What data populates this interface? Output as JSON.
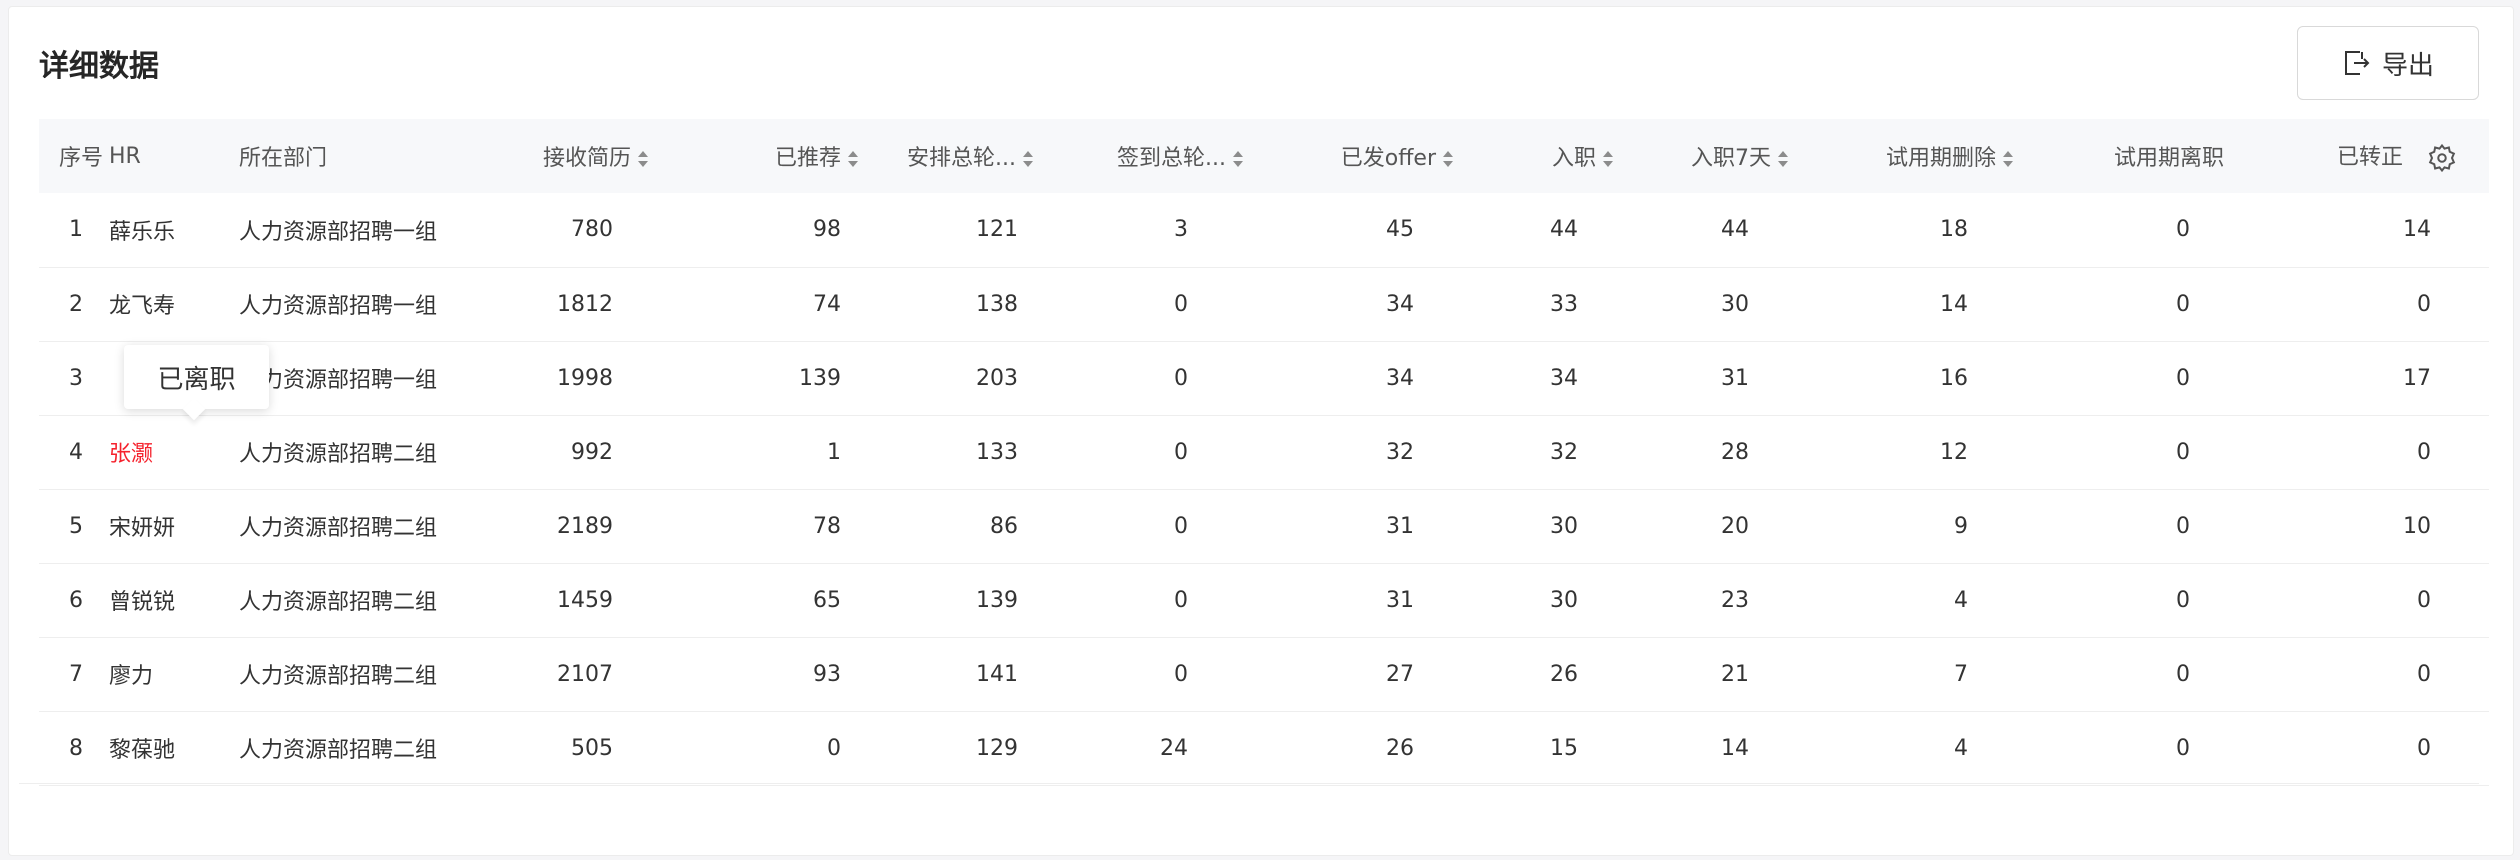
{
  "title": "详细数据",
  "export_label": "导出",
  "tooltip": "已离职",
  "columns": [
    {
      "label": "序号",
      "sortable": false
    },
    {
      "label": "HR",
      "sortable": false
    },
    {
      "label": "所在部门",
      "sortable": false
    },
    {
      "label": "接收简历",
      "sortable": true
    },
    {
      "label": "已推荐",
      "sortable": true
    },
    {
      "label": "安排总轮...",
      "sortable": true
    },
    {
      "label": "签到总轮...",
      "sortable": true
    },
    {
      "label": "已发offer",
      "sortable": true
    },
    {
      "label": "入职",
      "sortable": true
    },
    {
      "label": "入职7天",
      "sortable": true
    },
    {
      "label": "试用期删除",
      "sortable": true
    },
    {
      "label": "试用期离职",
      "sortable": false
    },
    {
      "label": "已转正",
      "sortable": false
    }
  ],
  "rows": [
    [
      "1",
      "薛乐乐",
      "人力资源部招聘一组",
      "780",
      "98",
      "121",
      "3",
      "45",
      "44",
      "44",
      "18",
      "0",
      "14"
    ],
    [
      "2",
      "龙飞寿",
      "人力资源部招聘一组",
      "1812",
      "74",
      "138",
      "0",
      "34",
      "33",
      "30",
      "14",
      "0",
      "0"
    ],
    [
      "3",
      "",
      "人力资源部招聘一组",
      "1998",
      "139",
      "203",
      "0",
      "34",
      "34",
      "31",
      "16",
      "0",
      "17"
    ],
    [
      "4",
      "张灏",
      "人力资源部招聘二组",
      "992",
      "1",
      "133",
      "0",
      "32",
      "32",
      "28",
      "12",
      "0",
      "0"
    ],
    [
      "5",
      "宋妍妍",
      "人力资源部招聘二组",
      "2189",
      "78",
      "86",
      "0",
      "31",
      "30",
      "20",
      "9",
      "0",
      "10"
    ],
    [
      "6",
      "曾锐锐",
      "人力资源部招聘二组",
      "1459",
      "65",
      "139",
      "0",
      "31",
      "30",
      "23",
      "4",
      "0",
      "0"
    ],
    [
      "7",
      "廖力",
      "人力资源部招聘二组",
      "2107",
      "93",
      "141",
      "0",
      "27",
      "26",
      "21",
      "7",
      "0",
      "0"
    ],
    [
      "8",
      "黎葆驰",
      "人力资源部招聘二组",
      "505",
      "0",
      "129",
      "24",
      "26",
      "15",
      "14",
      "4",
      "0",
      "0"
    ]
  ],
  "highlight_row": 3,
  "highlight_color": "#f5222d"
}
